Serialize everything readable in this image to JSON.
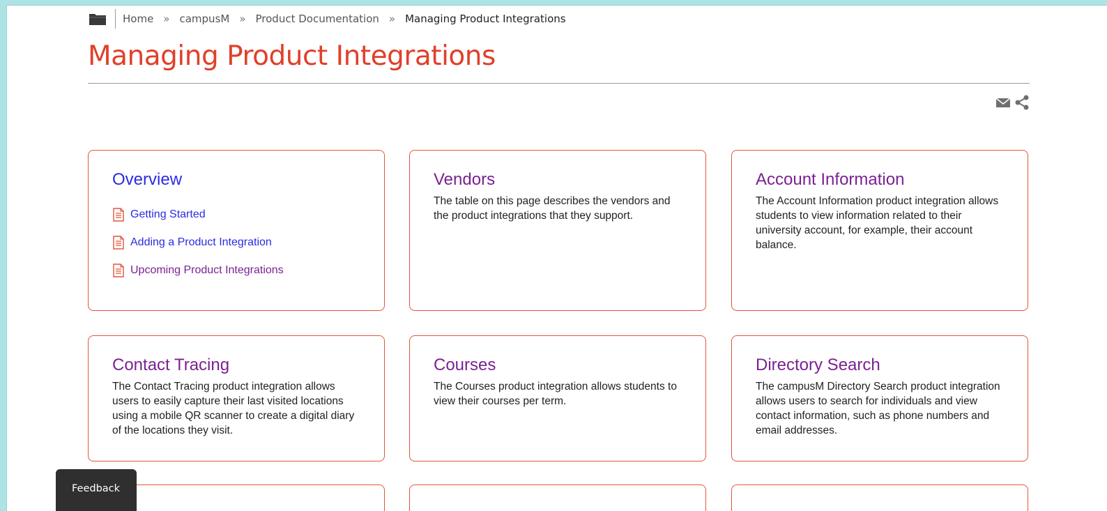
{
  "breadcrumb": {
    "items": [
      "Home",
      "campusM",
      "Product Documentation",
      "Managing Product Integrations"
    ],
    "separator": "»"
  },
  "page": {
    "title": "Managing Product Integrations"
  },
  "cards": [
    {
      "title": "Overview",
      "links": [
        {
          "label": "Getting Started"
        },
        {
          "label": "Adding a Product Integration"
        },
        {
          "label": "Upcoming Product Integrations"
        }
      ]
    },
    {
      "title": "Vendors",
      "description": "The table on this page describes the vendors and the product integrations that they support."
    },
    {
      "title": "Account Information",
      "description": "The Account Information product integration allows students to view information related to their university account, for example, their account balance."
    },
    {
      "title": "Contact Tracing",
      "description": "The Contact Tracing product integration allows users to easily capture their last visited locations using a mobile QR scanner to create a digital diary of the locations they visit."
    },
    {
      "title": "Courses",
      "description": "The Courses product integration allows students to view their courses per term."
    },
    {
      "title": "Directory Search",
      "description": "The campusM Directory Search product integration allows users to search for individuals and view contact information, such as phone numbers and email addresses."
    }
  ],
  "feedback": {
    "label": "Feedback"
  },
  "colors": {
    "accent": "#e0402a",
    "link": "#2b2be0",
    "visited": "#7b2192",
    "border": "#e2553c"
  }
}
